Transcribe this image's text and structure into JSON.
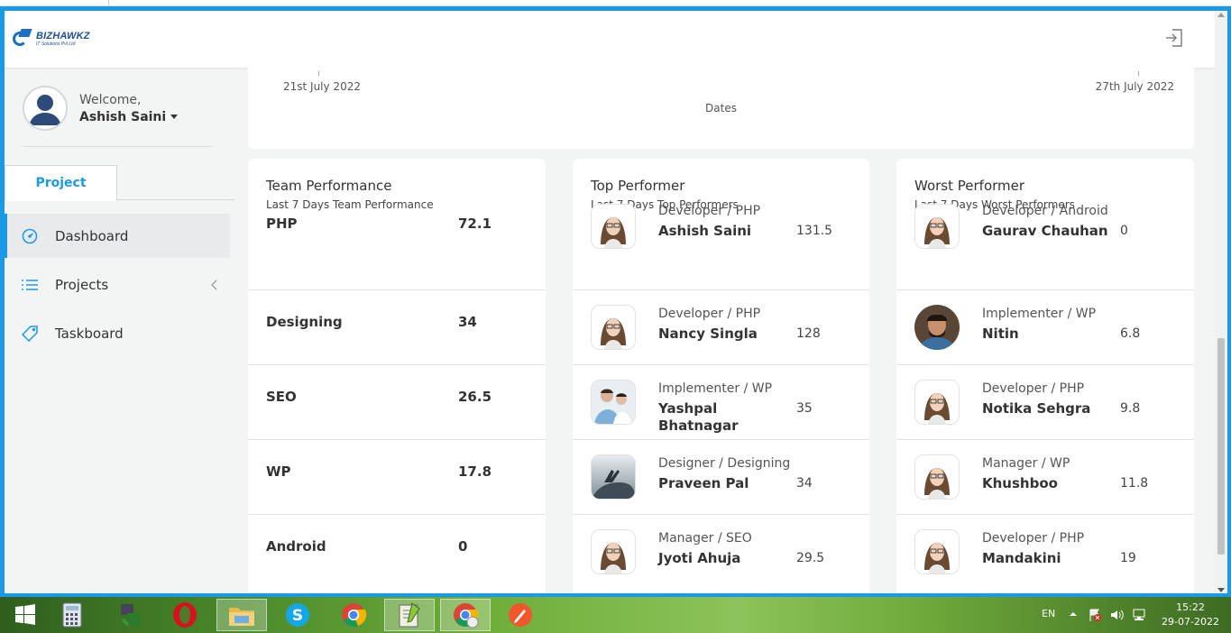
{
  "app": {
    "logo_name": "BIZHAWKZ",
    "logo_sub": "IT Solutions Pvt Ltd"
  },
  "user": {
    "welcome_label": "Welcome,",
    "name": "Ashish Saini"
  },
  "sidebar": {
    "tab_label": "Project",
    "items": [
      {
        "label": "Dashboard",
        "icon": "dashboard-gauge-icon"
      },
      {
        "label": "Projects",
        "icon": "list-icon"
      },
      {
        "label": "Taskboard",
        "icon": "tag-icon"
      }
    ]
  },
  "date_chart": {
    "start_label": "21st July 2022",
    "end_label": "27th July 2022",
    "x_axis_label": "Dates"
  },
  "team": {
    "title": "Team Performance",
    "subtitle": "Last 7 Days Team Performance",
    "rows": [
      {
        "name": "PHP",
        "value": "72.1"
      },
      {
        "name": "Designing",
        "value": "34"
      },
      {
        "name": "SEO",
        "value": "26.5"
      },
      {
        "name": "WP",
        "value": "17.8"
      },
      {
        "name": "Android",
        "value": "0"
      }
    ]
  },
  "top": {
    "title": "Top Performer",
    "subtitle": "Last 7 Days Top Performers",
    "rows": [
      {
        "role": "Developer / PHP",
        "name": "Ashish Saini",
        "score": "131.5",
        "photo": "female-avatar"
      },
      {
        "role": "Developer / PHP",
        "name": "Nancy Singla",
        "score": "128",
        "photo": "female-avatar"
      },
      {
        "role": "Implementer / WP",
        "name": "Yashpal Bhatnagar",
        "score": "35",
        "photo": "two-people-photo"
      },
      {
        "role": "Designer / Designing",
        "name": "Praveen Pal",
        "score": "34",
        "photo": "sky-hand-photo"
      },
      {
        "role": "Manager / SEO",
        "name": "Jyoti Ahuja",
        "score": "29.5",
        "photo": "female-avatar"
      }
    ]
  },
  "worst": {
    "title": "Worst Performer",
    "subtitle": "Last 7 Days Worst Performers",
    "rows": [
      {
        "role": "Developer / Android",
        "name": "Gaurav Chauhan",
        "score": "0",
        "photo": "female-avatar"
      },
      {
        "role": "Implementer / WP",
        "name": "Nitin",
        "score": "6.8",
        "photo": "man-photo"
      },
      {
        "role": "Developer / PHP",
        "name": "Notika Sehgra",
        "score": "9.8",
        "photo": "female-avatar"
      },
      {
        "role": "Manager / WP",
        "name": "Khushboo",
        "score": "11.8",
        "photo": "female-avatar"
      },
      {
        "role": "Developer / PHP",
        "name": "Mandakini",
        "score": "19",
        "photo": "female-avatar"
      }
    ]
  },
  "taskbar": {
    "apps": [
      "start-icon",
      "calculator-icon",
      "network-tool-icon",
      "opera-icon",
      "file-explorer-icon",
      "skype-icon",
      "chrome-icon",
      "notepad-plus-plus-icon",
      "chrome-user-icon",
      "pen-tool-icon"
    ],
    "language": "EN",
    "time": "15:22",
    "date": "29-07-2022"
  },
  "colors": {
    "accent": "#1a9ae6",
    "sidebar_bg": "#f3f4f4"
  }
}
